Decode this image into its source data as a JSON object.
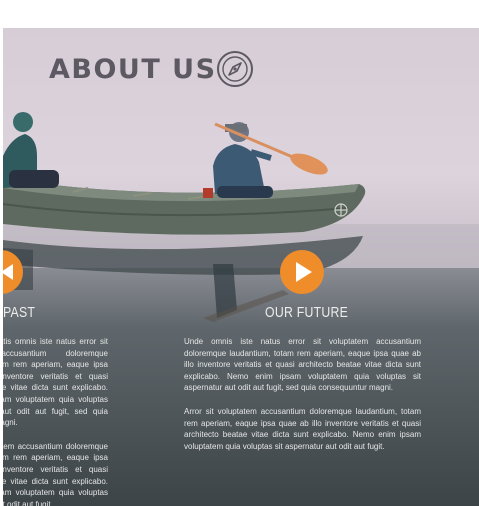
{
  "header": {
    "title": "ABOUT US",
    "icon": "compass-icon"
  },
  "carousel": {
    "prev_icon": "chevron-left-icon",
    "next_icon": "play-arrow-icon",
    "accent": "#ef8d2a"
  },
  "sections": {
    "past": {
      "heading": "PAST",
      "paragraphs": [
        "Sed ut perspiciatis omnis iste natus error sit voluptatem accusantium doloremque laudantium, totam rem aperiam, eaque ipsa quae ab illo inventore veritatis et quasi architecto beatae vitae dicta sunt explicabo. Nemo enim ipsam voluptatem quia voluptas sit aspernatur aut odit aut fugit, sed quia consequuntur magni.",
        "Arror sit voluptatem accusantium doloremque laudantium, totam rem aperiam, eaque ipsa quae ab illo inventore veritatis et quasi architecto beatae vitae dicta sunt explicabo. Nemo enim ipsam voluptatem quia voluptas sit aspernatur aut odit aut fugit."
      ]
    },
    "future": {
      "heading": "OUR FUTURE",
      "paragraphs": [
        "Unde omnis iste natus error sit voluptatem accusantium doloremque laudantium, totam rem aperiam, eaque ipsa quae ab illo inventore veritatis et quasi architecto beatae vitae dicta sunt explicabo. Nemo enim ipsam voluptatem quia voluptas sit aspernatur aut odit aut fugit, sed quia consequuntur magni.",
        "Arror sit voluptatem accusantium doloremque laudantium, totam rem aperiam, eaque ipsa quae ab illo inventore veritatis et quasi architecto beatae vitae dicta sunt explicabo. Nemo enim ipsam voluptatem quia voluptas sit aspernatur aut odit aut fugit."
      ]
    }
  }
}
